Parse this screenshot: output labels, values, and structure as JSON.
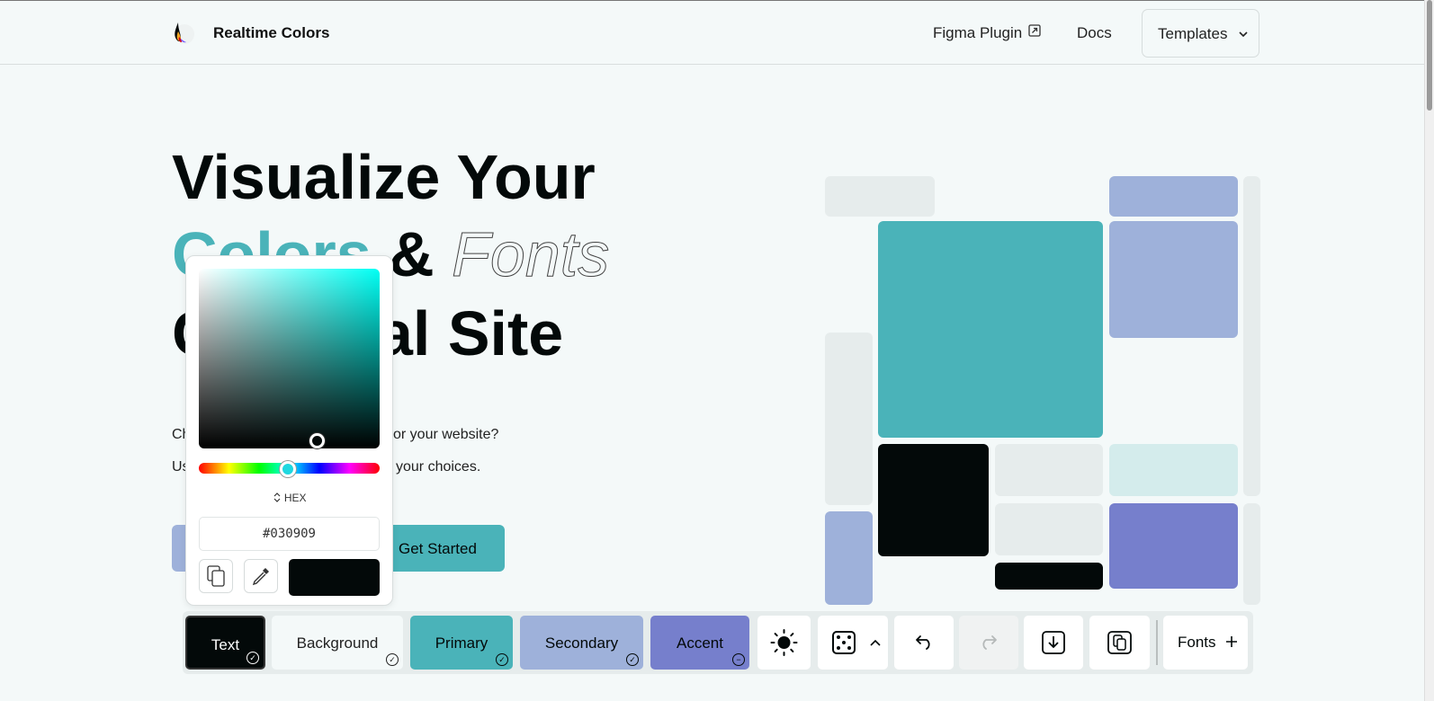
{
  "header": {
    "brand": "Realtime Colors",
    "nav": [
      "Figma Plugin",
      "Docs"
    ],
    "templates_label": "Templates"
  },
  "hero": {
    "line1": "Visualize Your",
    "line2_colors": "Colors",
    "line2_amp": "&",
    "line2_fonts": "Fonts",
    "line3_visible": "al Site",
    "sub1_visible_start": "Ch",
    "sub1_visible_end": "or your website?",
    "sub2_visible_start": "Us",
    "sub2_visible_end": "your choices.",
    "cta_label": "Get Started"
  },
  "picker": {
    "mode_label": "HEX",
    "hex_value": "#030909",
    "current_color": "#030909",
    "hue_position": 0.5
  },
  "toolbar": {
    "text_label": "Text",
    "background_label": "Background",
    "primary_label": "Primary",
    "secondary_label": "Secondary",
    "accent_label": "Accent",
    "fonts_label": "Fonts"
  },
  "colors": {
    "text": "#030909",
    "background": "#f4f9f9",
    "primary": "#4ab3b9",
    "secondary": "#9eb1da",
    "accent": "#767fcc"
  },
  "icons": [
    "logo-icon",
    "external-link-icon",
    "chevron-down-icon",
    "sort-icon",
    "copy-icon",
    "eyedropper-icon",
    "sun-icon",
    "dice-icon",
    "chevron-up-icon",
    "undo-icon",
    "redo-icon",
    "download-icon",
    "share-icon",
    "plus-icon"
  ]
}
